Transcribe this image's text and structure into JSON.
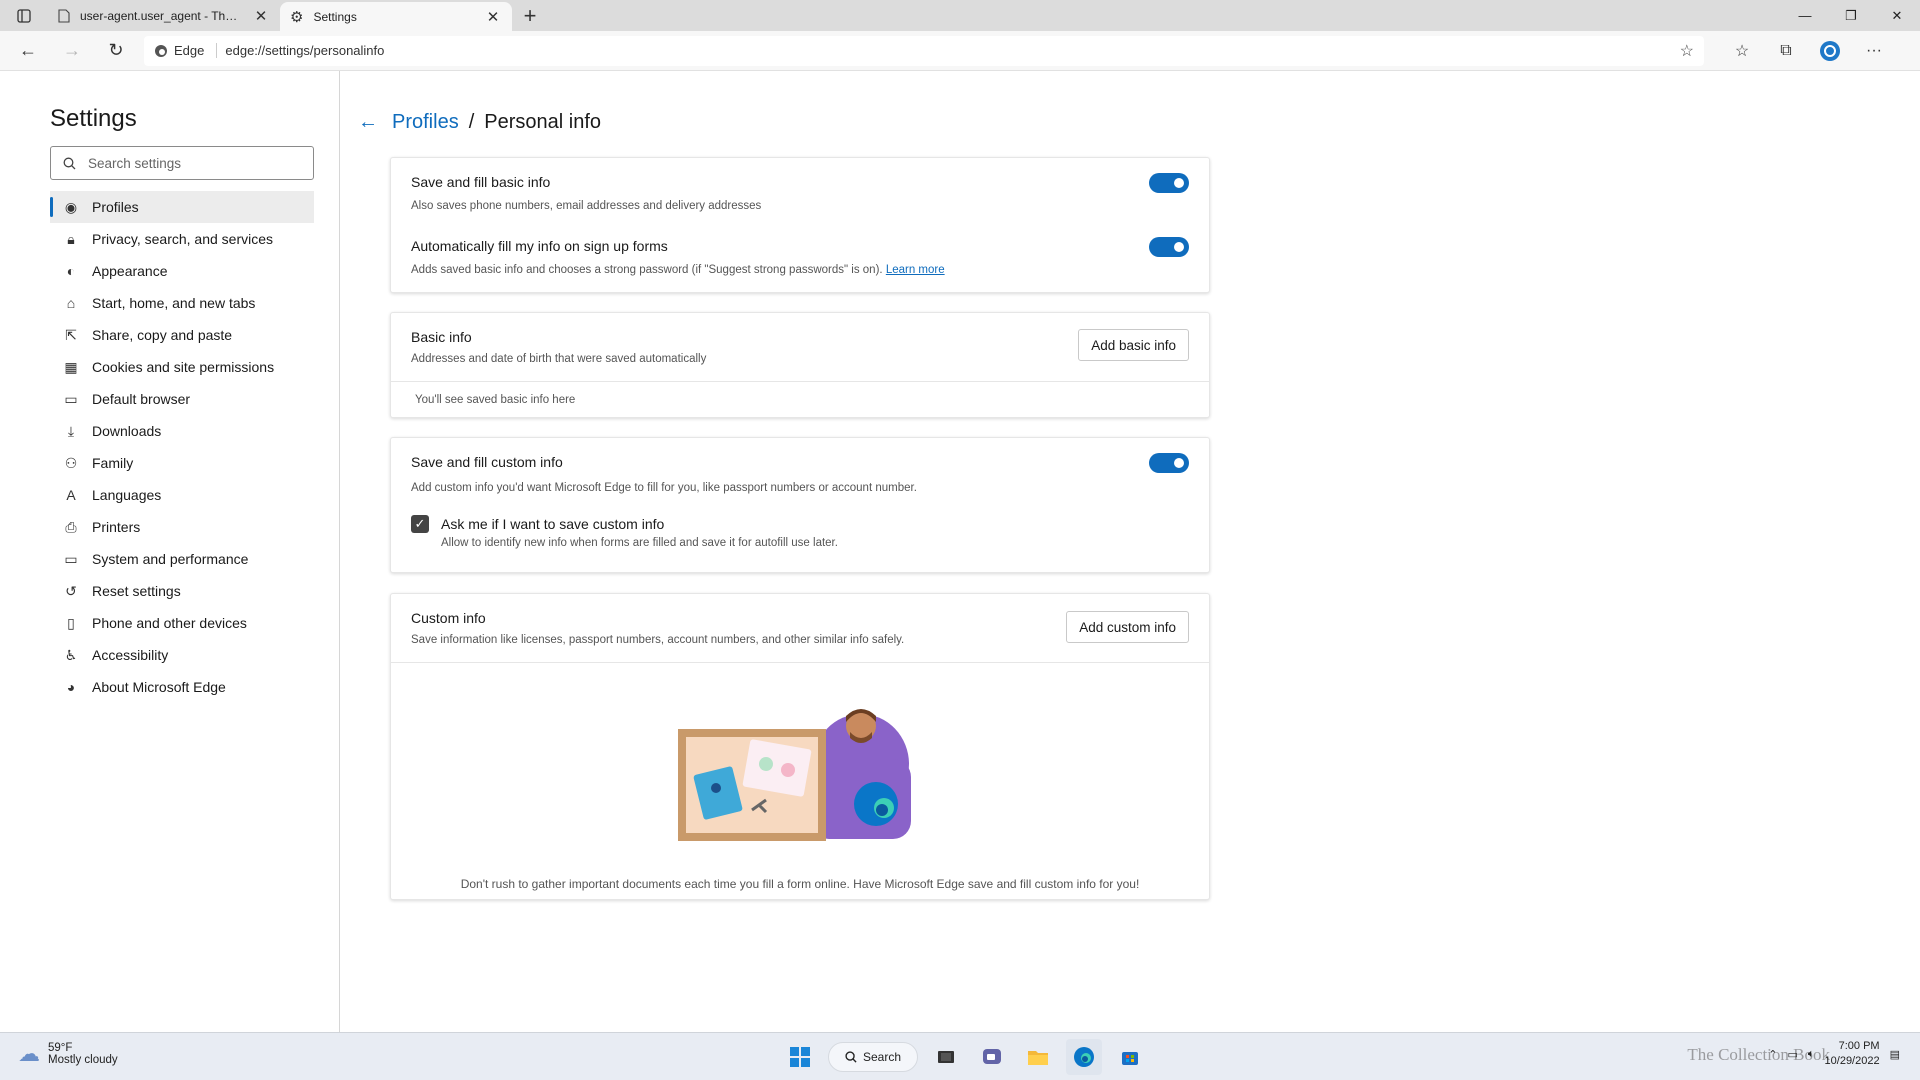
{
  "browser": {
    "tabs": [
      {
        "title": "user-agent.user_agent - The Coll",
        "icon": "page-icon",
        "active": false
      },
      {
        "title": "Settings",
        "icon": "gear-icon",
        "active": true
      }
    ],
    "site_label": "Edge",
    "url": "edge://settings/personalinfo"
  },
  "sidebar": {
    "title": "Settings",
    "search_placeholder": "Search settings",
    "items": [
      {
        "label": "Profiles",
        "icon": "profile-icon",
        "glyph": "◉",
        "active": true
      },
      {
        "label": "Privacy, search, and services",
        "icon": "lock-icon",
        "glyph": "🔒︎"
      },
      {
        "label": "Appearance",
        "icon": "appearance-icon",
        "glyph": "◐"
      },
      {
        "label": "Start, home, and new tabs",
        "icon": "home-icon",
        "glyph": "⌂"
      },
      {
        "label": "Share, copy and paste",
        "icon": "share-icon",
        "glyph": "⇱"
      },
      {
        "label": "Cookies and site permissions",
        "icon": "cookie-icon",
        "glyph": "▦"
      },
      {
        "label": "Default browser",
        "icon": "browser-icon",
        "glyph": "▭"
      },
      {
        "label": "Downloads",
        "icon": "download-icon",
        "glyph": "⤓"
      },
      {
        "label": "Family",
        "icon": "family-icon",
        "glyph": "⚇"
      },
      {
        "label": "Languages",
        "icon": "language-icon",
        "glyph": "A"
      },
      {
        "label": "Printers",
        "icon": "printer-icon",
        "glyph": "⎙"
      },
      {
        "label": "System and performance",
        "icon": "system-icon",
        "glyph": "▭"
      },
      {
        "label": "Reset settings",
        "icon": "reset-icon",
        "glyph": "↺"
      },
      {
        "label": "Phone and other devices",
        "icon": "phone-icon",
        "glyph": "▯"
      },
      {
        "label": "Accessibility",
        "icon": "accessibility-icon",
        "glyph": "♿︎"
      },
      {
        "label": "About Microsoft Edge",
        "icon": "edge-icon",
        "glyph": "◕"
      }
    ]
  },
  "main": {
    "breadcrumb_parent": "Profiles",
    "breadcrumb_sep": "/",
    "breadcrumb_current": "Personal info",
    "card1": {
      "row1_title": "Save and fill basic info",
      "row1_desc": "Also saves phone numbers, email addresses and delivery addresses",
      "row2_title": "Automatically fill my info on sign up forms",
      "row2_desc": "Adds saved basic info and chooses a strong password (if \"Suggest strong passwords\" is on).",
      "row2_link": "Learn more"
    },
    "card2": {
      "title": "Basic info",
      "desc": "Addresses and date of birth that were saved automatically",
      "button": "Add basic info",
      "empty": "You'll see saved basic info here"
    },
    "card3": {
      "title": "Save and fill custom info",
      "desc": "Add custom info you'd want Microsoft Edge to fill for you, like passport numbers or account number.",
      "check_title": "Ask me if I want to save custom info",
      "check_desc": "Allow to identify new info when forms are filled and save it for autofill use later."
    },
    "card4": {
      "title": "Custom info",
      "desc": "Save information like licenses, passport numbers, account numbers, and other similar info safely.",
      "button": "Add custom info",
      "footer": "Don't rush to gather important documents each time you fill a form online. Have Microsoft Edge save and fill custom info for you!"
    }
  },
  "taskbar": {
    "temp": "59°F",
    "weather": "Mostly cloudy",
    "search_label": "Search",
    "time": "7:00 PM",
    "date": "10/29/2022",
    "watermark": "The Collection Book"
  },
  "colors": {
    "accent": "#0f6cbd"
  }
}
